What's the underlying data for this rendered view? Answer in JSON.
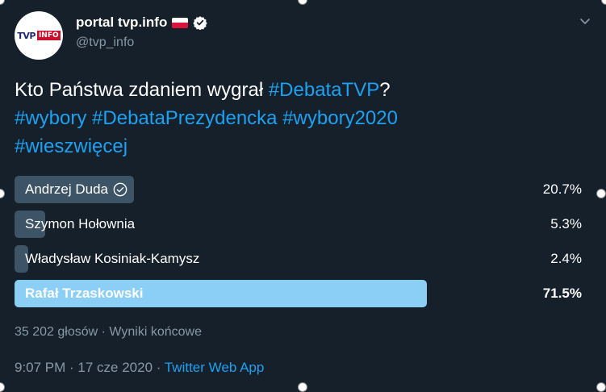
{
  "author": {
    "display_name": "portal tvp.info",
    "handle": "@tvp_info",
    "avatar_text_tvp": "TVP",
    "avatar_text_info": "INFO",
    "flag_icon": "poland-flag-icon",
    "verified_icon": "verified-badge-icon"
  },
  "tweet": {
    "text_plain": "Kto Państwa zdaniem wygrał ",
    "hashtag_1": "#DebataTVP",
    "text_q": "?",
    "hashtag_2": "#wybory",
    "hashtag_3": "#DebataPrezydencka",
    "hashtag_4": "#wybory2020",
    "hashtag_5": "#wieszwięcej"
  },
  "poll": {
    "options": [
      {
        "label": "Andrzej Duda",
        "percent": "20.7%",
        "share": 0.207,
        "voted": true
      },
      {
        "label": "Szymon Hołownia",
        "percent": "5.3%",
        "share": 0.053,
        "voted": false
      },
      {
        "label": "Władysław Kosiniak-Kamysz",
        "percent": "2.4%",
        "share": 0.024,
        "voted": false
      },
      {
        "label": "Rafał Trzaskowski",
        "percent": "71.5%",
        "share": 0.715,
        "voted": false,
        "winner": true
      }
    ],
    "meta": "35 202 głosów · Wyniki końcowe"
  },
  "footer": {
    "time_date": "9:07 PM · 17 cze 2020 · ",
    "app": "Twitter Web App"
  },
  "colors": {
    "background": "#15202b",
    "accent": "#1da1f2",
    "bar": "#3d5466",
    "winner_bar": "#8ccff6",
    "muted": "#8899a6"
  }
}
